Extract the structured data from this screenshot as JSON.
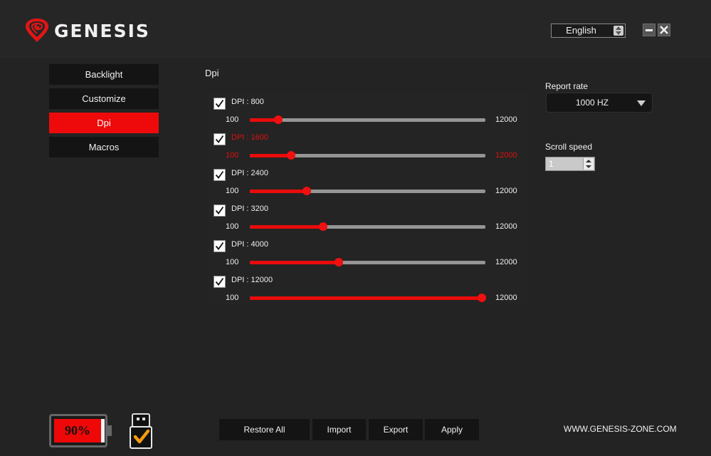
{
  "app": {
    "logo_text": "GENESIS"
  },
  "header": {
    "language": "English"
  },
  "sidebar": {
    "items": [
      {
        "label": "Backlight",
        "active": false
      },
      {
        "label": "Customize",
        "active": false
      },
      {
        "label": "Dpi",
        "active": true
      },
      {
        "label": "Macros",
        "active": false
      }
    ]
  },
  "dpi": {
    "title": "Dpi",
    "min": 100,
    "max": 12000,
    "levels": [
      {
        "label": "DPI : 800",
        "min_label": "100",
        "max_label": "12000",
        "value": 800,
        "checked": true,
        "highlighted": false
      },
      {
        "label": "DPI : 1600",
        "min_label": "100",
        "max_label": "12000",
        "value": 1600,
        "checked": true,
        "highlighted": true
      },
      {
        "label": "DPI : 2400",
        "min_label": "100",
        "max_label": "12000",
        "value": 2400,
        "checked": true,
        "highlighted": false
      },
      {
        "label": "DPI : 3200",
        "min_label": "100",
        "max_label": "12000",
        "value": 3200,
        "checked": true,
        "highlighted": false
      },
      {
        "label": "DPI : 4000",
        "min_label": "100",
        "max_label": "12000",
        "value": 4000,
        "checked": true,
        "highlighted": false
      },
      {
        "label": "DPI : 12000",
        "min_label": "100",
        "max_label": "12000",
        "value": 12000,
        "checked": true,
        "highlighted": false
      }
    ]
  },
  "report_rate": {
    "label": "Report rate",
    "value": "1000 HZ"
  },
  "scroll_speed": {
    "label": "Scroll speed",
    "value": "1"
  },
  "battery": {
    "percent_label": "90%",
    "level": 0.9
  },
  "footer": {
    "restore_label": "Restore All",
    "import_label": "Import",
    "export_label": "Export",
    "apply_label": "Apply",
    "website": "WWW.GENESIS-ZONE.COM"
  },
  "colors": {
    "accent": "#ee0a0a",
    "background": "#232323",
    "button_bg": "#141414"
  }
}
